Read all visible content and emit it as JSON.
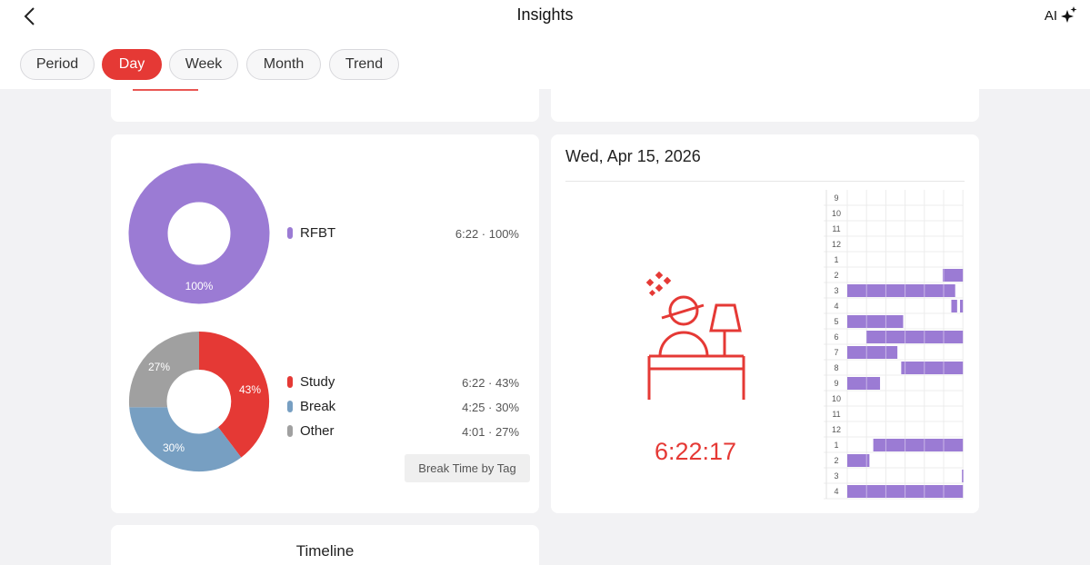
{
  "header": {
    "title": "Insights",
    "ai_label": "AI"
  },
  "tabs": [
    {
      "label": "Period",
      "active": false
    },
    {
      "label": "Day",
      "active": true
    },
    {
      "label": "Week",
      "active": false
    },
    {
      "label": "Month",
      "active": false
    },
    {
      "label": "Trend",
      "active": false
    }
  ],
  "project_distribution": {
    "center_label": "100%",
    "items": [
      {
        "name": "RFBT",
        "value": "6:22 · 100%",
        "color": "#9b7bd4"
      }
    ]
  },
  "tag_distribution": {
    "items": [
      {
        "name": "Study",
        "value": "6:22 · 43%",
        "percent_label": "43%",
        "color": "#e53935"
      },
      {
        "name": "Break",
        "value": "4:25 · 30%",
        "percent_label": "30%",
        "color": "#779fc2"
      },
      {
        "name": "Other",
        "value": "4:01 · 27%",
        "percent_label": "27%",
        "color": "#a0a0a0"
      }
    ],
    "break_button_label": "Break Time by Tag"
  },
  "day_detail": {
    "date": "Wed, Apr 15, 2026",
    "focus_time": "6:22:17",
    "hour_labels": [
      "9",
      "10",
      "11",
      "12",
      "1",
      "2",
      "3",
      "4",
      "5",
      "6",
      "7",
      "8",
      "9",
      "10",
      "11",
      "12",
      "1",
      "2",
      "3",
      "4"
    ]
  },
  "timeline": {
    "title": "Timeline"
  },
  "colors": {
    "accent": "#e53935",
    "project": "#9b7bd4",
    "background": "#f2f2f4"
  }
}
